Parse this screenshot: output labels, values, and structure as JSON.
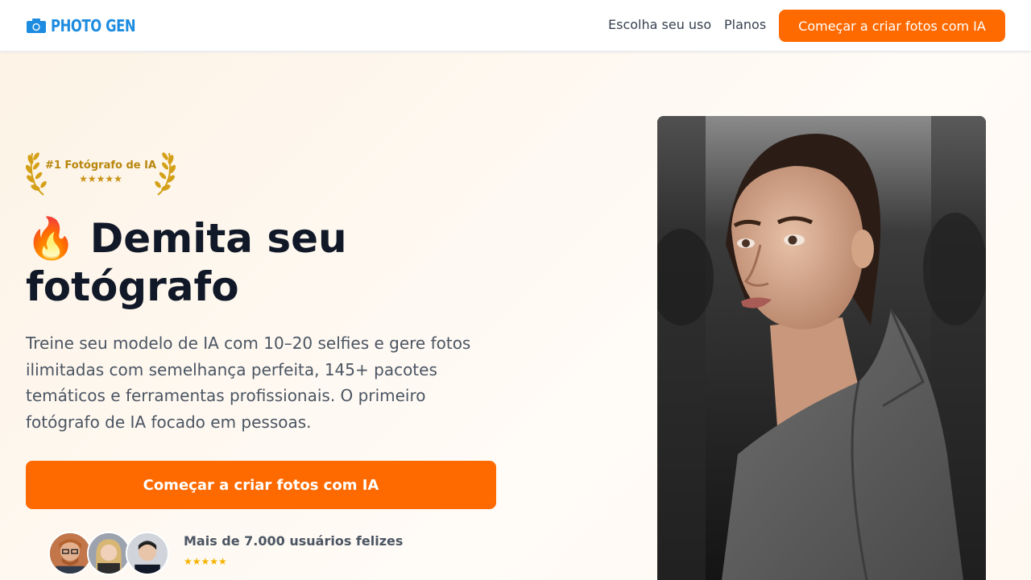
{
  "header": {
    "logo_text": "PHOTO GEN",
    "nav": [
      "Escolha seu uso",
      "Planos"
    ],
    "cta_label": "Começar a criar fotos com IA"
  },
  "hero": {
    "award": {
      "title": "#1 Fotógrafo de IA",
      "stars": "★★★★★"
    },
    "emoji": "🔥",
    "headline": "Demita seu fotógrafo",
    "subtext": "Treine seu modelo de IA com 10–20 selfies e gere fotos ilimitadas com semelhança perfeita, 145+ pacotes temáticos e ferramentas profissionais. O primeiro fotógrafo de IA focado em pessoas.",
    "cta_label": "Começar a criar fotos com IA",
    "social_proof": {
      "title": "Mais de 7.000 usuários felizes",
      "stars": "★★★★★"
    }
  },
  "colors": {
    "brand_blue": "#1d8ce0",
    "accent_orange": "#ff6a00",
    "award_gold": "#b8860b",
    "star_yellow": "#f5b301"
  },
  "icons": [
    "camera-icon",
    "laurel-left-icon",
    "laurel-right-icon",
    "fire-emoji"
  ]
}
